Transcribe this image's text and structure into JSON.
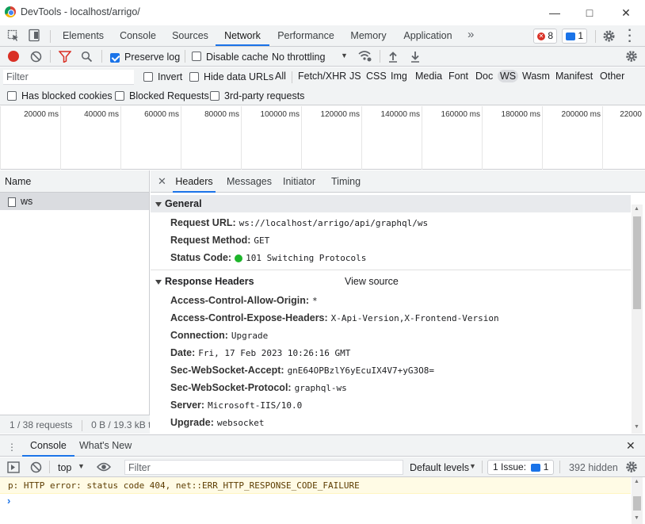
{
  "window": {
    "title": "DevTools - localhost/arrigo/"
  },
  "main_tabs": [
    {
      "label": "Elements"
    },
    {
      "label": "Console"
    },
    {
      "label": "Sources"
    },
    {
      "label": "Network"
    },
    {
      "label": "Performance"
    },
    {
      "label": "Memory"
    },
    {
      "label": "Application"
    }
  ],
  "active_tab": "Network",
  "badges": {
    "errors": "8",
    "messages": "1"
  },
  "net_toolbar": {
    "preserve_log": "Preserve log",
    "disable_cache": "Disable cache",
    "throttling": "No throttling"
  },
  "filter": {
    "placeholder": "Filter",
    "invert": "Invert",
    "hide_data_urls": "Hide data URLs",
    "types": [
      "All",
      "Fetch/XHR",
      "JS",
      "CSS",
      "Img",
      "Media",
      "Font",
      "Doc",
      "WS",
      "Wasm",
      "Manifest",
      "Other"
    ],
    "active_type": "WS",
    "has_blocked_cookies": "Has blocked cookies",
    "blocked_requests": "Blocked Requests",
    "third_party": "3rd-party requests"
  },
  "timeline": {
    "ticks": [
      "20000 ms",
      "40000 ms",
      "60000 ms",
      "80000 ms",
      "100000 ms",
      "120000 ms",
      "140000 ms",
      "160000 ms",
      "180000 ms",
      "200000 ms",
      "22000"
    ]
  },
  "request_list": {
    "header": "Name",
    "rows": [
      {
        "name": "ws"
      }
    ],
    "footer_requests": "1 / 38 requests",
    "footer_size": "0 B / 19.3 kB tr"
  },
  "detail_tabs": [
    "Headers",
    "Messages",
    "Initiator",
    "Timing"
  ],
  "active_detail_tab": "Headers",
  "general": {
    "title": "General",
    "rows": [
      {
        "key": "Request URL:",
        "value": "ws://localhost/arrigo/api/graphql/ws"
      },
      {
        "key": "Request Method:",
        "value": "GET"
      },
      {
        "key": "Status Code:",
        "value": "101 Switching Protocols"
      }
    ]
  },
  "response_headers": {
    "title": "Response Headers",
    "view_source": "View source",
    "rows": [
      {
        "key": "Access-Control-Allow-Origin:",
        "value": "*"
      },
      {
        "key": "Access-Control-Expose-Headers:",
        "value": "X-Api-Version,X-Frontend-Version"
      },
      {
        "key": "Connection:",
        "value": "Upgrade"
      },
      {
        "key": "Date:",
        "value": "Fri, 17 Feb 2023 10:26:16 GMT"
      },
      {
        "key": "Sec-WebSocket-Accept:",
        "value": "gnE64OPBzlY6yEcuIX4V7+yG3O8="
      },
      {
        "key": "Sec-WebSocket-Protocol:",
        "value": "graphql-ws"
      },
      {
        "key": "Server:",
        "value": "Microsoft-IIS/10.0"
      },
      {
        "key": "Upgrade:",
        "value": "websocket"
      }
    ]
  },
  "drawer": {
    "tabs": [
      "Console",
      "What's New"
    ],
    "context": "top",
    "filter_placeholder": "Filter",
    "levels": "Default levels",
    "issues": "1 Issue:",
    "issues_count": "1",
    "hidden": "392 hidden",
    "message": "p: HTTP error: status code 404, net::ERR_HTTP_RESPONSE_CODE_FAILURE"
  },
  "colors": {
    "accent": "#1a73e8",
    "error": "#d93025",
    "status_ok": "#1db52b"
  }
}
